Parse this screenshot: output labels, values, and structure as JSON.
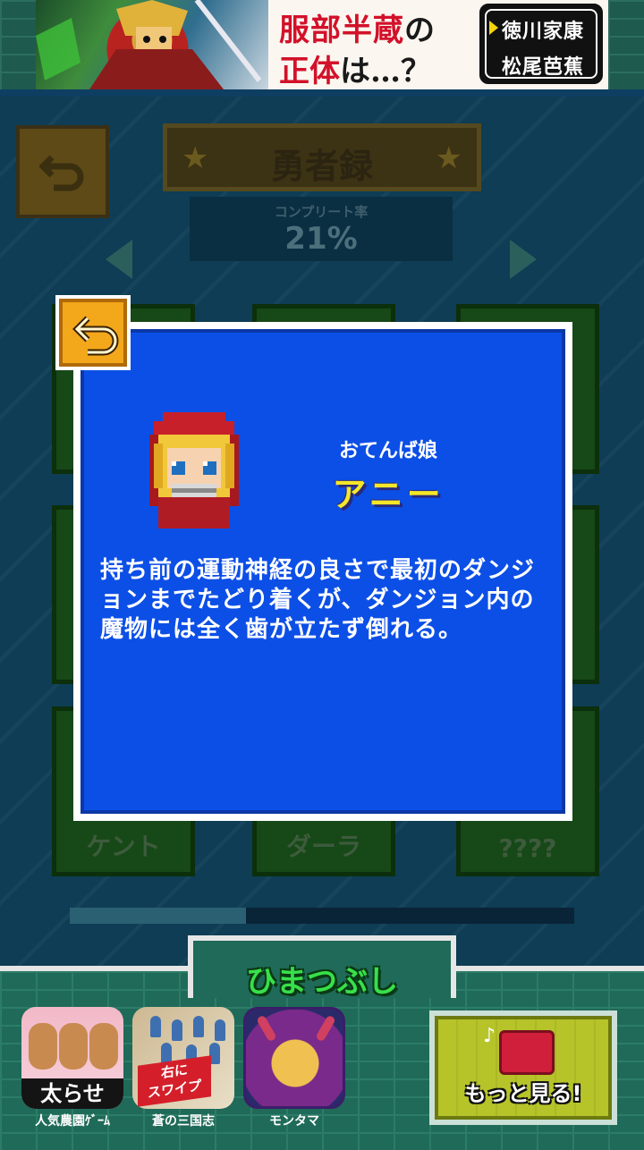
{
  "ad_banner": {
    "headline_red": "服部半蔵",
    "headline_no": "の",
    "line2_red": "正体",
    "line2_rest": "は…？",
    "choices": [
      "徳川家康",
      "松尾芭蕉"
    ]
  },
  "screen": {
    "title": "勇者録",
    "complete_label": "コンプリート率",
    "complete_value": "21%",
    "cards": [
      {
        "name": "ケント"
      },
      {
        "name": "ダーラ"
      },
      {
        "name": "????"
      }
    ],
    "page_progress": 0.35
  },
  "modal": {
    "character_title": "おてんば娘",
    "character_name": "アニー",
    "description": "持ち前の運動神経の良さで最初のダンジョンまでたどり着くが、ダンジョン内の魔物には全く歯が立たず倒れる。"
  },
  "footer": {
    "title": "ひまつぶし",
    "apps": [
      {
        "label": "人気農園ｹﾞｰﾑ",
        "tag": "太らせ"
      },
      {
        "label": "蒼の三国志",
        "badge": "右に\nスワイプ"
      },
      {
        "label": "モンタマ"
      }
    ],
    "more_label": "もっと見る!"
  },
  "colors": {
    "modal_blue": "#0c4fe6",
    "name_yellow": "#f5e728",
    "footer_green_text": "#38e04a",
    "close_orange": "#f3a71a"
  },
  "icons": [
    "back-arrow-icon",
    "star-icon",
    "chest-icon",
    "music-note-icon"
  ]
}
